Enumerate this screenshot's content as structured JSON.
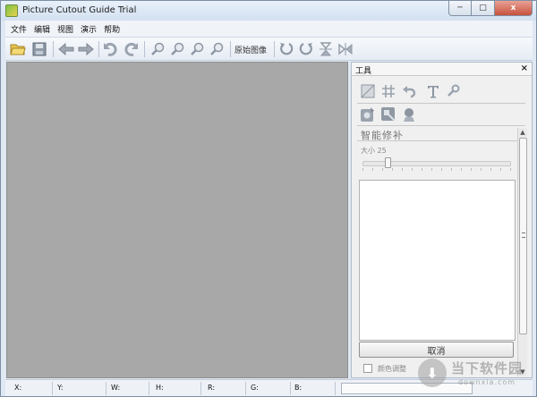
{
  "window": {
    "title": "Picture Cutout Guide Trial",
    "controls": {
      "minimize": "─",
      "maximize": "□",
      "close": "x"
    }
  },
  "menu": [
    "文件",
    "编辑",
    "视图",
    "演示",
    "帮助"
  ],
  "toolbar": {
    "original_image_label": "原始图像",
    "icons": [
      "open-folder-icon",
      "save-icon",
      "back-arrow-icon",
      "forward-arrow-icon",
      "undo-icon",
      "redo-icon",
      "zoom-in-icon",
      "zoom-out-icon",
      "zoom-fit-icon",
      "zoom-actual-icon",
      "rotate-left-icon",
      "rotate-right-icon",
      "flip-vertical-icon",
      "flip-horizontal-icon"
    ]
  },
  "tool_panel": {
    "title": "工具",
    "close": "×",
    "section_title": "智能修补",
    "size_label": "大小 25",
    "size_value": 25,
    "cancel_label": "取消",
    "color_adjust_label": "颜色调整"
  },
  "status_bar": {
    "x": "X:",
    "y": "Y:",
    "w": "W:",
    "h": "H:",
    "r": "R:",
    "g": "G:",
    "b": "B:"
  },
  "watermark": {
    "brand": "当下软件园",
    "domain": "downxia.com"
  },
  "colors": {
    "canvas": "#a8a8a8",
    "chrome": "#dfe8f3",
    "close_button": "#c8523d"
  }
}
